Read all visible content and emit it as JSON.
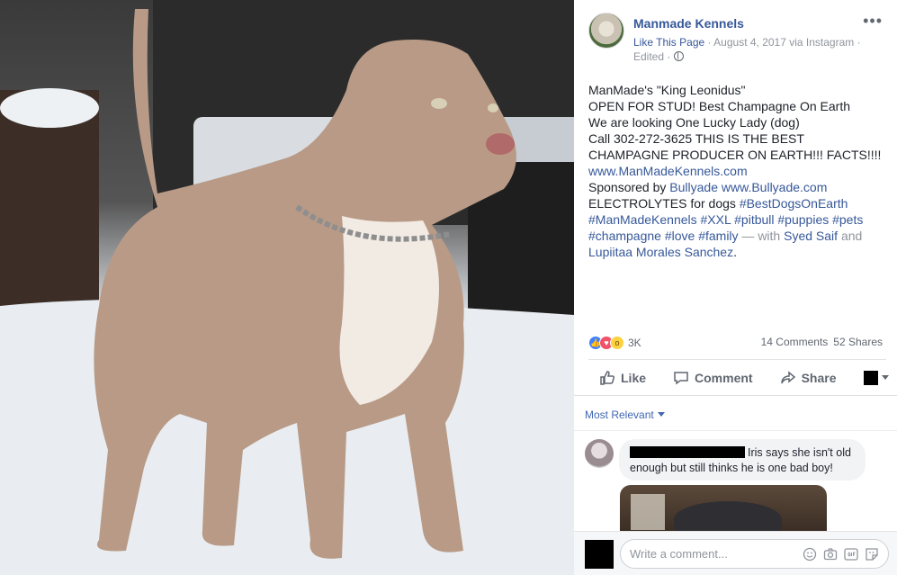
{
  "post": {
    "page_name": "Manmade Kennels",
    "like_page": "Like This Page",
    "meta_text": " · August 4, 2017 via Instagram · ",
    "edited": "Edited · ",
    "lines": [
      "ManMade's \"King Leonidus\"",
      "OPEN FOR STUD! Best Champagne On Earth",
      "We are looking One Lucky Lady (dog)",
      "Call 302-272-3625 THIS IS THE BEST",
      "CHAMPAGNE PRODUCER ON EARTH!!! FACTS!!!!"
    ],
    "website": "www.ManMadeKennels.com",
    "sponsored_prefix": "Sponsored by ",
    "sponsor_name": "Bullyade",
    "sponsor_site": "www.Bullyade.com",
    "electrolytes": "ELECTROLYTES for dogs ",
    "tag1": "#BestDogsOnEarth",
    "tags_line": "#ManMadeKennels #XXL #pitbull #puppies #pets",
    "tags_line2": "#champagne #love #family",
    "with_text": " — with ",
    "with_person1": "Syed Saif",
    "and_text": " and",
    "with_person2": "Lupiitaa Morales Sanchez",
    "period": "."
  },
  "stats": {
    "reaction_count": "3K",
    "comments": "14 Comments",
    "shares": "52 Shares"
  },
  "actions": {
    "like": "Like",
    "comment": "Comment",
    "share": "Share"
  },
  "comments": {
    "sort": "Most Relevant",
    "first_text_a": "Iris says she isn't old",
    "first_text_b": "enough but still thinks he is one bad boy!"
  },
  "composer": {
    "placeholder": "Write a comment..."
  },
  "colors": {
    "link": "#365899",
    "meta": "#90949c"
  }
}
